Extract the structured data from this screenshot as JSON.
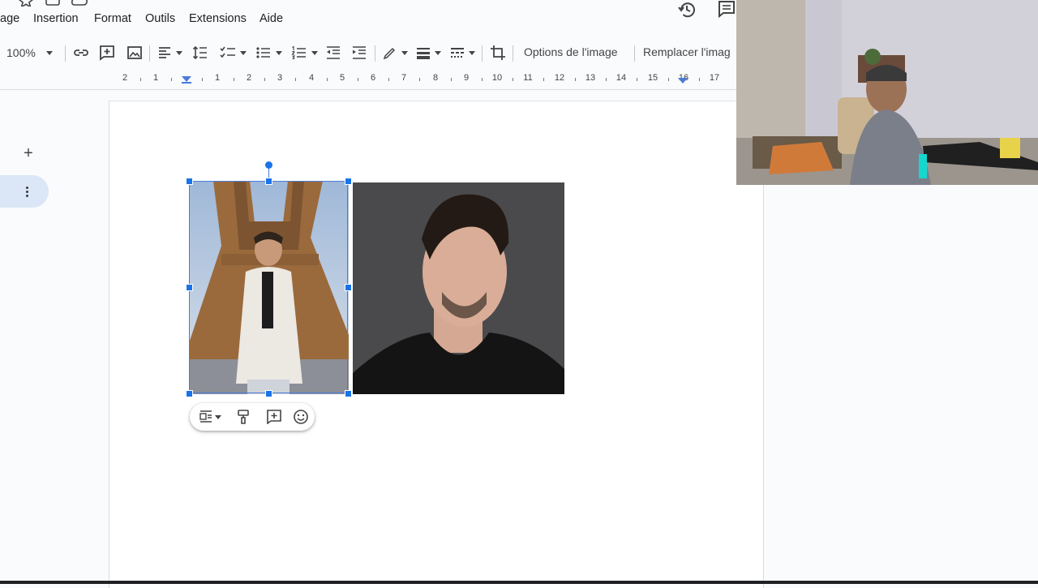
{
  "menu": {
    "items": [
      "age",
      "Insertion",
      "Format",
      "Outils",
      "Extensions",
      "Aide"
    ]
  },
  "toolbar": {
    "zoom": "100%",
    "image_options_label": "Options de l'image",
    "replace_image_label": "Remplacer l'imag"
  },
  "ruler": {
    "marks": [
      "2",
      "1",
      "1",
      "2",
      "3",
      "4",
      "5",
      "6",
      "7",
      "8",
      "9",
      "10",
      "11",
      "12",
      "13",
      "14",
      "15",
      "16",
      "17"
    ]
  },
  "left_tools": {
    "add_symbol": "+"
  },
  "colors": {
    "accent": "#1a73e8",
    "selection": "#4a7bd8",
    "active_pill": "#dbe6f6",
    "page_bg": "#f9fbfd"
  }
}
